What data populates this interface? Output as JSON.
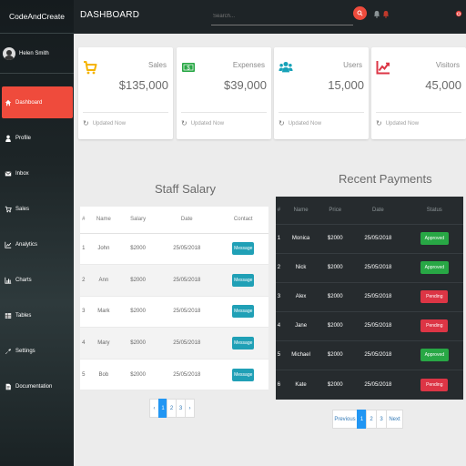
{
  "brand": "CodeAndCreate",
  "user": {
    "name": "Helen Smith"
  },
  "sidebar": {
    "items": [
      {
        "label": "Dashboard",
        "icon": "home-icon",
        "active": true
      },
      {
        "label": "Profile",
        "icon": "user-icon"
      },
      {
        "label": "Inbox",
        "icon": "envelope-icon"
      },
      {
        "label": "Sales",
        "icon": "cart-icon"
      },
      {
        "label": "Analytics",
        "icon": "line-chart-icon"
      },
      {
        "label": "Charts",
        "icon": "bar-chart-icon"
      },
      {
        "label": "Tables",
        "icon": "table-icon"
      },
      {
        "label": "Settings",
        "icon": "wrench-icon"
      },
      {
        "label": "Documentation",
        "icon": "document-icon"
      }
    ]
  },
  "header": {
    "title": "DASHBOARD",
    "search_placeholder": "Search..."
  },
  "cards": [
    {
      "label": "Sales",
      "value": "$135,000",
      "icon": "cart-icon",
      "color": "#f5b400",
      "updated": "Updated Now"
    },
    {
      "label": "Expenses",
      "value": "$39,000",
      "icon": "money-icon",
      "color": "#28a745",
      "updated": "Updated Now"
    },
    {
      "label": "Users",
      "value": "15,000",
      "icon": "users-icon",
      "color": "#17a2b8",
      "updated": "Updated Now"
    },
    {
      "label": "Visitors",
      "value": "45,000",
      "icon": "chart-line-icon",
      "color": "#dc3545",
      "updated": "Updated Now"
    }
  ],
  "staff_salary": {
    "title": "Staff Salary",
    "columns": [
      "#",
      "Name",
      "Salary",
      "Date",
      "Contact"
    ],
    "button_label": "Message",
    "rows": [
      {
        "num": "1",
        "name": "John",
        "salary": "$2000",
        "date": "25/05/2018"
      },
      {
        "num": "2",
        "name": "Ann",
        "salary": "$2000",
        "date": "25/05/2018"
      },
      {
        "num": "3",
        "name": "Mark",
        "salary": "$2000",
        "date": "25/05/2018"
      },
      {
        "num": "4",
        "name": "Mary",
        "salary": "$2000",
        "date": "25/05/2018"
      },
      {
        "num": "5",
        "name": "Bob",
        "salary": "$2000",
        "date": "25/05/2018"
      }
    ],
    "pagination": {
      "prev": "‹",
      "pages": [
        "1",
        "2",
        "3"
      ],
      "next": "›",
      "active": 0
    }
  },
  "recent_payments": {
    "title": "Recent Payments",
    "columns": [
      "#",
      "Name",
      "Price",
      "Date",
      "Status"
    ],
    "rows": [
      {
        "num": "1",
        "name": "Monica",
        "price": "$2000",
        "date": "25/05/2018",
        "status": "Approved"
      },
      {
        "num": "2",
        "name": "Nick",
        "price": "$2000",
        "date": "25/05/2018",
        "status": "Approved"
      },
      {
        "num": "3",
        "name": "Alex",
        "price": "$2000",
        "date": "25/05/2018",
        "status": "Pending"
      },
      {
        "num": "4",
        "name": "Jane",
        "price": "$2000",
        "date": "25/05/2018",
        "status": "Pending"
      },
      {
        "num": "5",
        "name": "Michael",
        "price": "$2000",
        "date": "25/05/2018",
        "status": "Approved"
      },
      {
        "num": "6",
        "name": "Kate",
        "price": "$2000",
        "date": "25/05/2018",
        "status": "Pending"
      }
    ],
    "pagination": {
      "prev": "Previous",
      "pages": [
        "1",
        "2",
        "3"
      ],
      "next": "Next",
      "active": 0
    }
  },
  "colors": {
    "accent": "#ef4b3c",
    "approved": "#28a745",
    "pending": "#dc3545",
    "message_button": "#20a0b6",
    "pager_active": "#2196f3"
  }
}
